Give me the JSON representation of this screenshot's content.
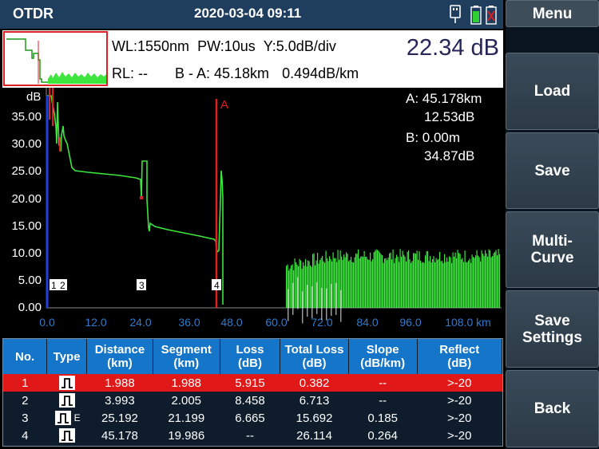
{
  "topbar": {
    "title": "OTDR",
    "datetime": "2020-03-04 09:11",
    "icons": [
      "usb-icon",
      "battery-icon",
      "battery-empty-icon"
    ]
  },
  "info": {
    "wl": "WL:1550nm",
    "pw": "PW:10us",
    "y": "Y:5.0dB/div",
    "big_value": "22.34 dB",
    "rl": "RL: --",
    "ba": "B - A: 45.18km",
    "slope": "0.494dB/km"
  },
  "plot": {
    "y_unit": "dB",
    "y_ticks": [
      "35.00",
      "30.00",
      "25.00",
      "20.00",
      "15.00",
      "10.00",
      "5.00",
      "0.00"
    ],
    "x_ticks": [
      "0.0",
      "12.0",
      "24.0",
      "36.0",
      "48.0",
      "60.0",
      "72.0",
      "84.0",
      "96.0",
      "108.0 km"
    ],
    "cursor_a_label": "A",
    "event_markers": [
      "1",
      "2",
      "3",
      "4"
    ],
    "readout": {
      "a_distance": "A: 45.178km",
      "a_db": "12.53dB",
      "b_distance": "B: 0.00m",
      "b_db": "34.87dB"
    },
    "trace_color": "#3ce63c",
    "cursor_a_color": "#e02020",
    "cursor_b_color": "#2040e0"
  },
  "events": {
    "headers": [
      {
        "line1": "No.",
        "line2": ""
      },
      {
        "line1": "Type",
        "line2": ""
      },
      {
        "line1": "Distance",
        "line2": "(km)"
      },
      {
        "line1": "Segment",
        "line2": "(km)"
      },
      {
        "line1": "Loss",
        "line2": "(dB)"
      },
      {
        "line1": "Total Loss",
        "line2": "(dB)"
      },
      {
        "line1": "Slope",
        "line2": "(dB/km)"
      },
      {
        "line1": "Reflect",
        "line2": "(dB)"
      }
    ],
    "rows": [
      {
        "no": "1",
        "type_extra": "",
        "distance": "1.988",
        "segment": "1.988",
        "loss": "5.915",
        "total": "0.382",
        "slope": "--",
        "reflect": ">-20"
      },
      {
        "no": "2",
        "type_extra": "",
        "distance": "3.993",
        "segment": "2.005",
        "loss": "8.458",
        "total": "6.713",
        "slope": "--",
        "reflect": ">-20"
      },
      {
        "no": "3",
        "type_extra": "E",
        "distance": "25.192",
        "segment": "21.199",
        "loss": "6.665",
        "total": "15.692",
        "slope": "0.185",
        "reflect": ">-20"
      },
      {
        "no": "4",
        "type_extra": "",
        "distance": "45.178",
        "segment": "19.986",
        "loss": "--",
        "total": "26.114",
        "slope": "0.264",
        "reflect": ">-20"
      }
    ],
    "selected_row": 0
  },
  "menu": {
    "items": [
      {
        "line1": "Menu",
        "line2": ""
      },
      {
        "line1": "Load",
        "line2": ""
      },
      {
        "line1": "Save",
        "line2": ""
      },
      {
        "line1": "Multi-",
        "line2": "Curve"
      },
      {
        "line1": "Save",
        "line2": "Settings"
      },
      {
        "line1": "Back",
        "line2": ""
      }
    ]
  }
}
